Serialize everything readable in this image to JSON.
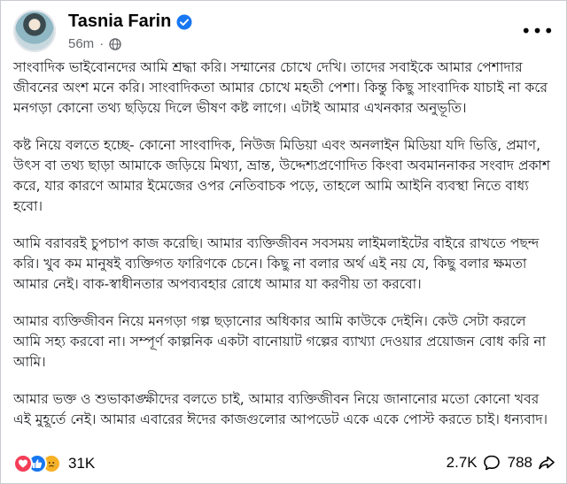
{
  "author": {
    "name": "Tasnia Farin",
    "verified_icon": "verified-badge-icon",
    "avatar_icon": "profile-avatar",
    "time": "56m",
    "separator": "·",
    "audience_icon": "globe-icon"
  },
  "menu": {
    "icon": "more-options-icon",
    "label": "•••"
  },
  "post": {
    "paragraphs": [
      "সাংবাদিক ভাইবোনদের আমি শ্রদ্ধা করি। সম্মানের চোখে দেখি। তাদের সবাইকে আমার পেশাদার জীবনের অংশ মনে করি। সাংবাদিকতা আমার চোখে মহতী পেশা। কিন্তু কিছু সাংবাদিক যাচাই না করে মনগড়া কোনো তথ্য ছড়িয়ে দিলে ভীষণ কষ্ট লাগে। এটাই আমার এখনকার অনুভূতি।",
      "কষ্ট নিয়ে বলতে হচ্ছে- কোনো সাংবাদিক, নিউজ মিডিয়া এবং অনলাইন মিডিয়া যদি ভিত্তি, প্রমাণ, উৎস বা তথ্য ছাড়া আমাকে জড়িয়ে মিথ্যা, ভ্রান্ত, উদ্দেশ্যপ্রণোদিত কিংবা অবমাননাকর সংবাদ প্রকাশ করে, যার কারণে আমার ইমেজের ওপর নেতিবাচক পড়ে, তাহলে আমি আইনি ব্যবস্থা নিতে বাধ্য হবো।",
      "আমি বরাবরই চুপচাপ কাজ করেছি। আমার ব্যক্তিজীবন সবসময় লাইমলাইটের বাইরে রাখতে পছন্দ করি। খুব কম মানুষই ব্যক্তিগত ফারিণকে চেনে। কিছু না বলার অর্থ এই নয় যে, কিছু বলার ক্ষমতা আমার নেই। বাক-স্বাধীনতার অপব্যবহার রোধে আমার যা করণীয় তা করবো।",
      "আমার ব্যক্তিজীবন নিয়ে মনগড়া গল্প ছড়ানোর অধিকার আমি কাউকে দেইনি। কেউ সেটা করলে আমি সহ্য করবো না। সম্পূর্ণ কাল্পনিক একটা বানোয়াট গল্পের ব্যাখ্যা দেওয়ার প্রয়োজন বোধ করি না আমি।",
      "আমার ভক্ত ও শুভাকাঙ্ক্ষীদের বলতে চাই, আমার ব্যক্তিজীবন নিয়ে জানানোর মতো কোনো খবর এই মুহূর্তে নেই। আমার এবারের ঈদের কাজগুলোর আপডেট একে একে পোস্ট করতে চাই। ধন্যবাদ।"
    ]
  },
  "footer": {
    "reactions": [
      "love-reaction-icon",
      "like-reaction-icon",
      "sad-reaction-icon"
    ],
    "reaction_count": "31K",
    "comment_count": "2.7K",
    "comment_icon": "comment-icon",
    "share_count": "788",
    "share_icon": "share-icon"
  },
  "colors": {
    "verified": "#1877f2",
    "love": "#f33e58",
    "like": "#1877f2",
    "sad": "#f7b125",
    "meta_text": "#65676b"
  }
}
